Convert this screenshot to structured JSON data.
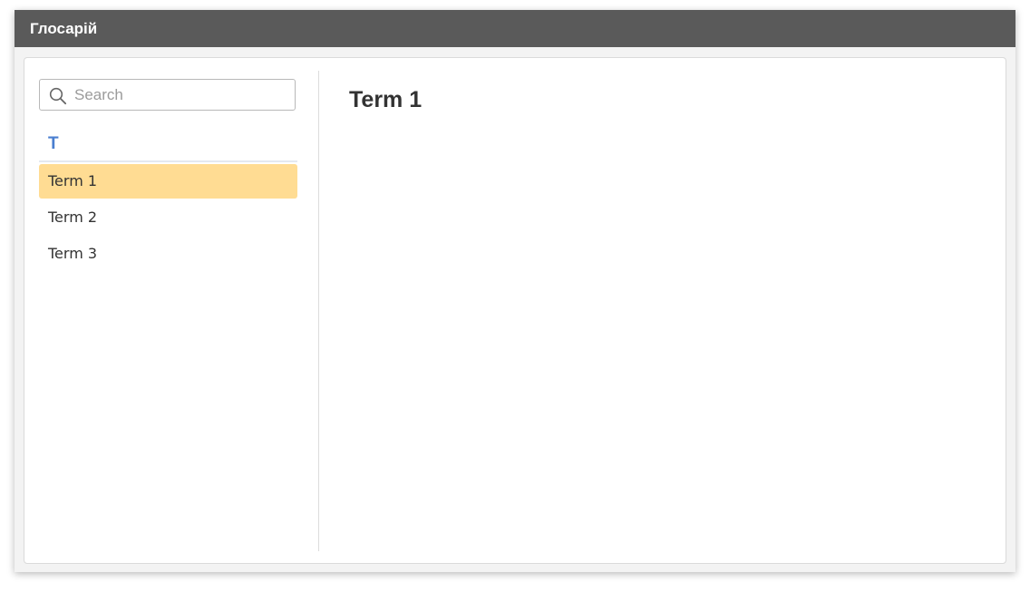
{
  "window": {
    "title": "Глосарій"
  },
  "search": {
    "placeholder": "Search",
    "value": "",
    "icon": "search-icon"
  },
  "glossary": {
    "letter": "T",
    "terms": [
      "Term 1",
      "Term 2",
      "Term 3"
    ],
    "selected_index": 0
  },
  "content": {
    "title": "Term 1"
  },
  "colors": {
    "titlebar": "#5a5a5a",
    "letter_accent": "#4a7fd0",
    "selected_background": "#ffdc93"
  }
}
